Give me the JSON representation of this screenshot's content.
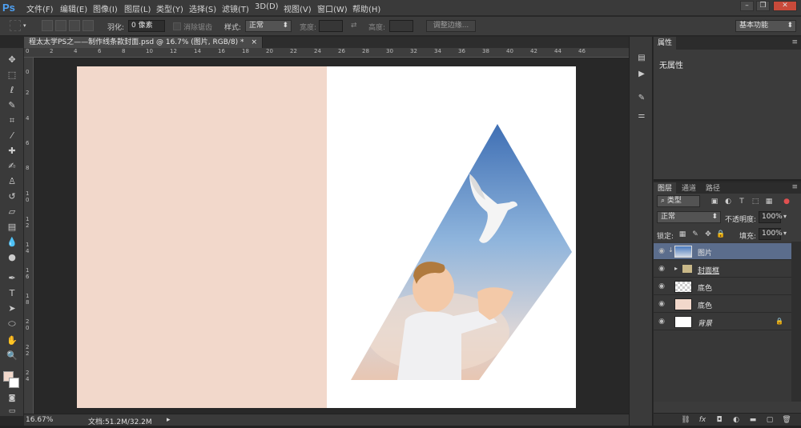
{
  "app": {
    "logo": "Ps"
  },
  "menu": [
    "文件(F)",
    "编辑(E)",
    "图像(I)",
    "图层(L)",
    "类型(Y)",
    "选择(S)",
    "滤镜(T)",
    "3D(D)",
    "视图(V)",
    "窗口(W)",
    "帮助(H)"
  ],
  "window_controls": {
    "minimize": "–",
    "restore": "❐",
    "close": "✕"
  },
  "options": {
    "feather_label": "羽化:",
    "feather_value": "0 像素",
    "antialias_label": "消除锯齿",
    "style_label": "样式:",
    "style_value": "正常",
    "width_label": "宽度:",
    "height_label": "高度:",
    "refine_edge": "调整边缘...",
    "workspace": "基本功能"
  },
  "document": {
    "tab_title": "程太太学PS之——制作线条款封面.psd @ 16.7% (图片, RGB/8) *",
    "tab_close": "×",
    "canvas_left_color": "#f2d8cb",
    "canvas_right_color": "#ffffff"
  },
  "rulers": {
    "top": [
      "0",
      "2",
      "4",
      "6",
      "8",
      "10",
      "12",
      "14",
      "16",
      "18",
      "20",
      "22",
      "24",
      "26",
      "28",
      "30",
      "32",
      "34",
      "36",
      "38",
      "40",
      "42",
      "44",
      "46"
    ],
    "left": [
      "0",
      "2",
      "4",
      "6",
      "8",
      "1 0",
      "1 2",
      "1 4",
      "1 6",
      "1 8",
      "2 0",
      "2 2",
      "2 4"
    ]
  },
  "status": {
    "zoom": "16.67%",
    "doc_size": "文档:51.2M/32.2M",
    "arrow": "▸"
  },
  "properties": {
    "tab": "属性",
    "content": "无属性"
  },
  "layers_panel": {
    "tabs": [
      "图层",
      "通道",
      "路径"
    ],
    "filter_kind": "类型",
    "blend_mode": "正常",
    "opacity_label": "不透明度:",
    "opacity_value": "100%",
    "lock_label": "锁定:",
    "fill_label": "填充:",
    "fill_value": "100%",
    "layers": [
      {
        "name": "图片",
        "selected": true,
        "thumb": "image"
      },
      {
        "name": "封面框",
        "selected": false,
        "thumb": "folder"
      },
      {
        "name": "底色",
        "selected": false,
        "thumb": "transparent"
      },
      {
        "name": "底色",
        "selected": false,
        "thumb": "peach"
      },
      {
        "name": "背景",
        "selected": false,
        "thumb": "white"
      }
    ]
  },
  "icons": {
    "eye": "👁",
    "lock": "🔒",
    "fx": "fx",
    "folder": "▸"
  }
}
